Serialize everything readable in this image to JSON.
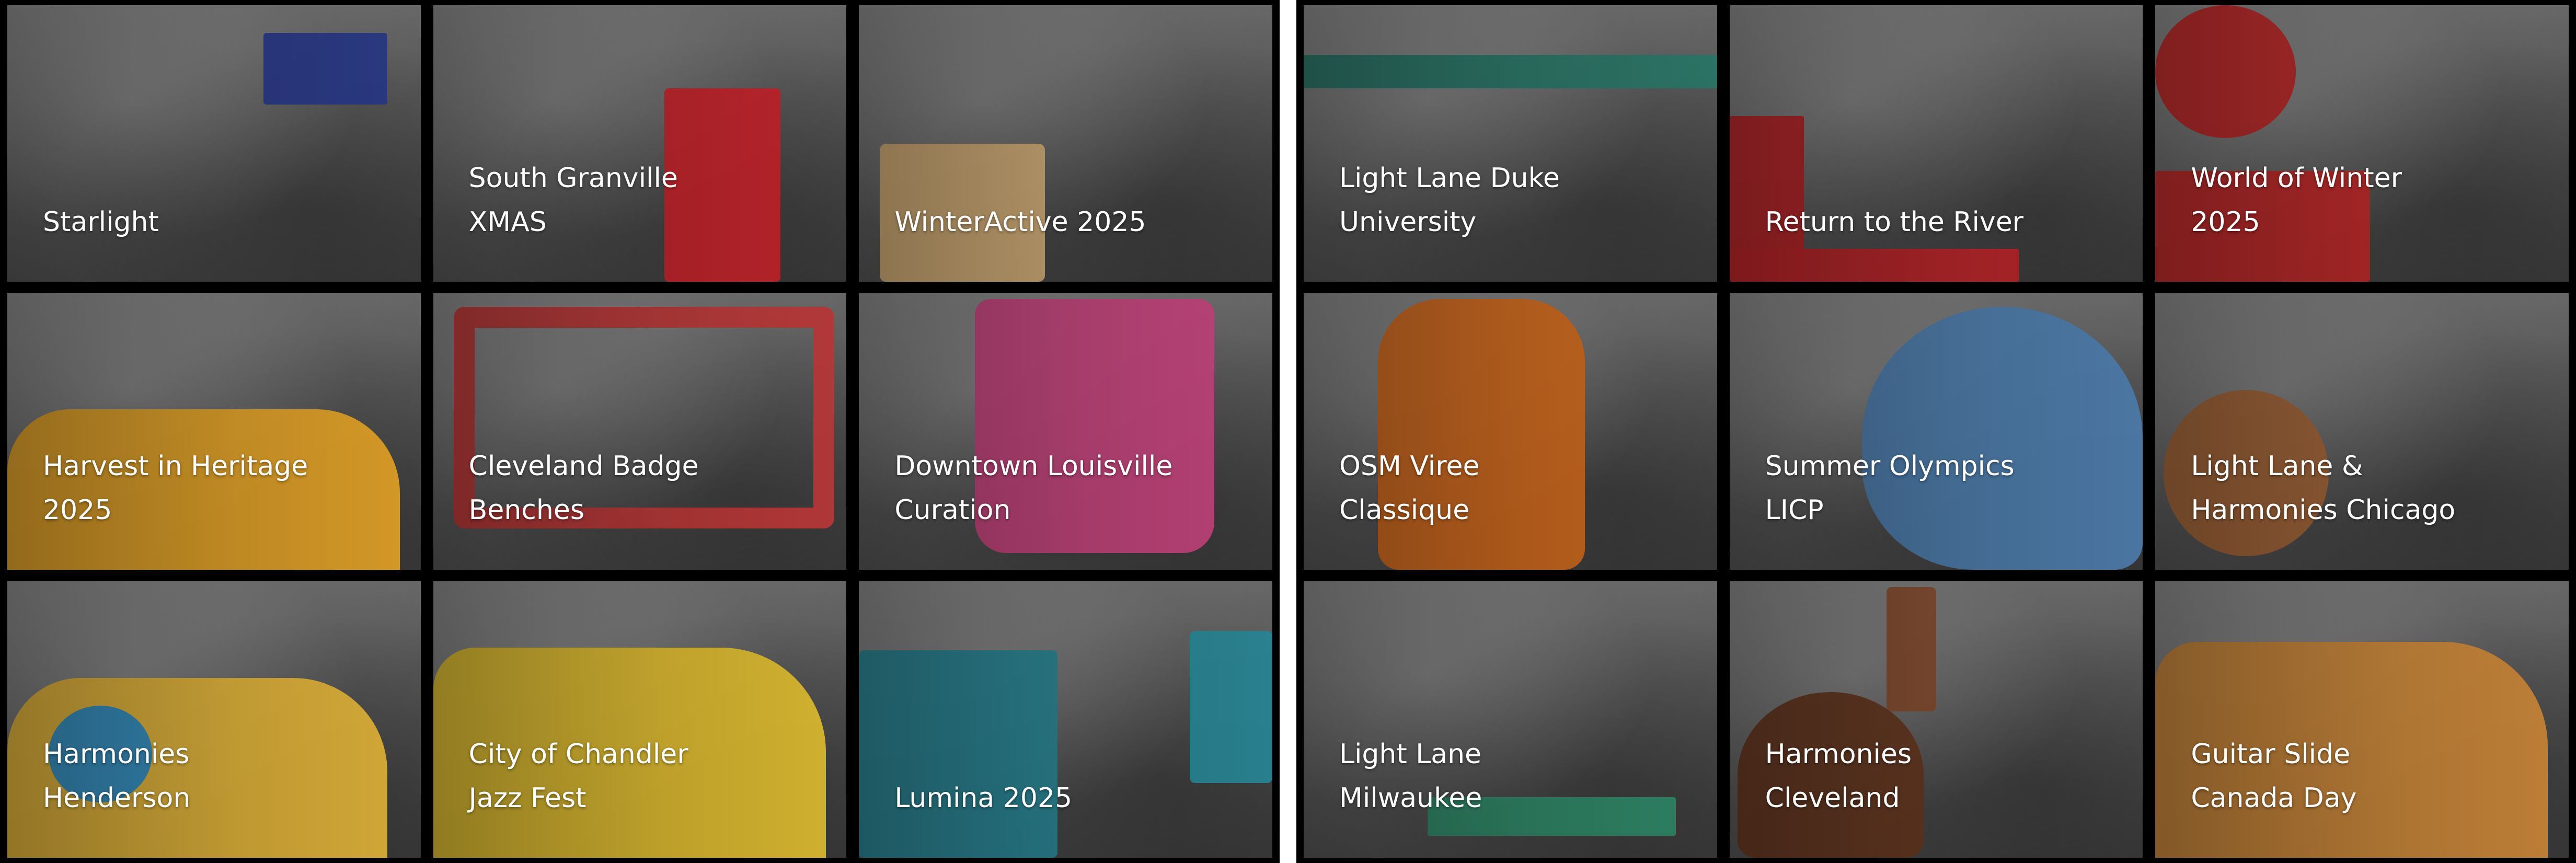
{
  "gallery": {
    "left_tiles": [
      {
        "title": "Starlight",
        "accent": "#2a3a8a"
      },
      {
        "title": "South Granville\nXMAS",
        "accent": "#c8242b"
      },
      {
        "title": "WinterActive 2025",
        "accent": "#d9b37a"
      },
      {
        "title": "Harvest in Heritage\n2025",
        "accent": "#e9a728"
      },
      {
        "title": "Cleveland Badge\nBenches",
        "accent": "#c23a3a"
      },
      {
        "title": "Downtown Louisville\nCuration",
        "accent": "#c8467f"
      },
      {
        "title": "Harmonies\nHenderson",
        "accent": "#2f8fc8"
      },
      {
        "title": "City of Chandler\nJazz Fest",
        "accent": "#e6c230"
      },
      {
        "title": "Lumina 2025",
        "accent": "#2a8a9a"
      }
    ],
    "right_tiles": [
      {
        "title": "Light Lane Duke\nUniversity",
        "accent": "#2b7a6a"
      },
      {
        "title": "Return to the River",
        "accent": "#c0262a"
      },
      {
        "title": "World of Winter\n2025",
        "accent": "#c62a2a"
      },
      {
        "title": "OSM Viree\nClassique",
        "accent": "#d36a1e"
      },
      {
        "title": "Summer Olympics\nLICP",
        "accent": "#4f7fb0"
      },
      {
        "title": "Light Lane &\nHarmonies Chicago",
        "accent": "#a9683a"
      },
      {
        "title": "Light Lane\nMilwaukee",
        "accent": "#2f8a6a"
      },
      {
        "title": "Harmonies\nCleveland",
        "accent": "#6a3a22"
      },
      {
        "title": "Guitar Slide\nCanada Day",
        "accent": "#d08a3a"
      }
    ]
  }
}
